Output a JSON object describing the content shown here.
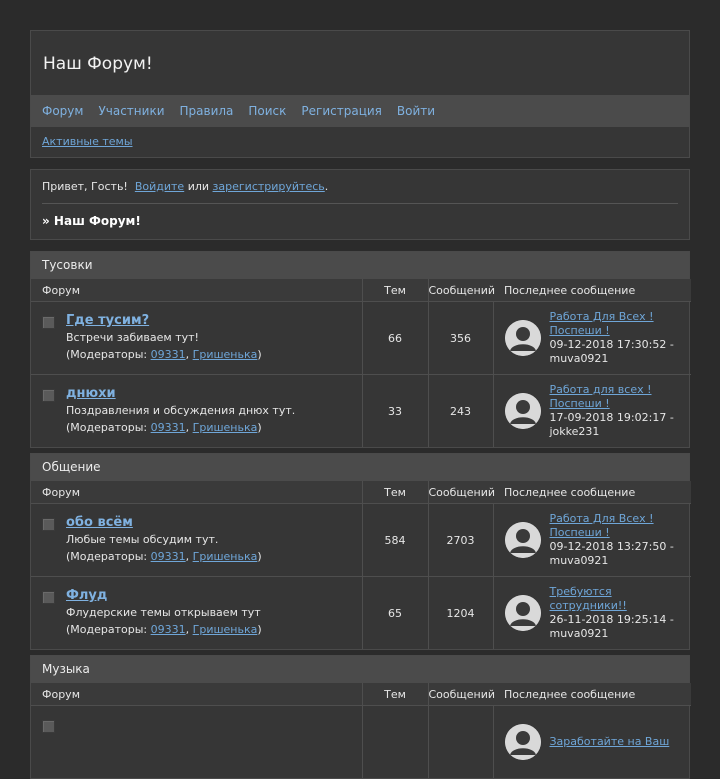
{
  "site": {
    "title": "Наш Форум!"
  },
  "nav": [
    "Форум",
    "Участники",
    "Правила",
    "Поиск",
    "Регистрация",
    "Войти"
  ],
  "subnav": {
    "active_topics": "Активные темы"
  },
  "welcome": {
    "greeting": "Привет, Гость!",
    "login": "Войдите",
    "or": "или",
    "register": "зарегистрируйтесь",
    "dot": ".",
    "breadcrumb": "» Наш Форум!"
  },
  "columns": {
    "forum": "Форум",
    "topics": "Тем",
    "posts": "Сообщений",
    "last": "Последнее сообщение"
  },
  "moderators_label": "(Модераторы:",
  "categories": [
    {
      "title": "Тусовки",
      "forums": [
        {
          "name": "Где тусим?",
          "desc": "Встречи забиваем тут!",
          "mods": [
            "09331",
            "Гришенька"
          ],
          "topics": "66",
          "posts": "356",
          "last_title": "Работа Для Всех ! Поспеши !",
          "last_date": "09-12-2018 17:30:52 -",
          "last_user": "muva0921"
        },
        {
          "name": "днюхи",
          "desc": "Поздравления и обсуждения днюх тут.",
          "mods": [
            "09331",
            "Гришенька"
          ],
          "topics": "33",
          "posts": "243",
          "last_title": "Работа для всех ! Поспеши !",
          "last_date": "17-09-2018 19:02:17 -",
          "last_user": "jokke231"
        }
      ]
    },
    {
      "title": "Общение",
      "forums": [
        {
          "name": "обо всём",
          "desc": "Любые темы обсудим тут.",
          "mods": [
            "09331",
            "Гришенька"
          ],
          "topics": "584",
          "posts": "2703",
          "last_title": "Работа Для Всех ! Поспеши !",
          "last_date": "09-12-2018 13:27:50 -",
          "last_user": "muva0921"
        },
        {
          "name": "Флуд",
          "desc": "Флудерские темы открываем тут",
          "mods": [
            "09331",
            "Гришенька"
          ],
          "topics": "65",
          "posts": "1204",
          "last_title": "Требуются сотрудники!!",
          "last_date": "26-11-2018 19:25:14 -",
          "last_user": "muva0921"
        }
      ]
    },
    {
      "title": "Музыка",
      "forums": [
        {
          "name": "",
          "desc": "",
          "mods": [],
          "topics": "",
          "posts": "",
          "last_title": "Заработайте на Ваш",
          "last_date": "",
          "last_user": ""
        }
      ]
    }
  ]
}
